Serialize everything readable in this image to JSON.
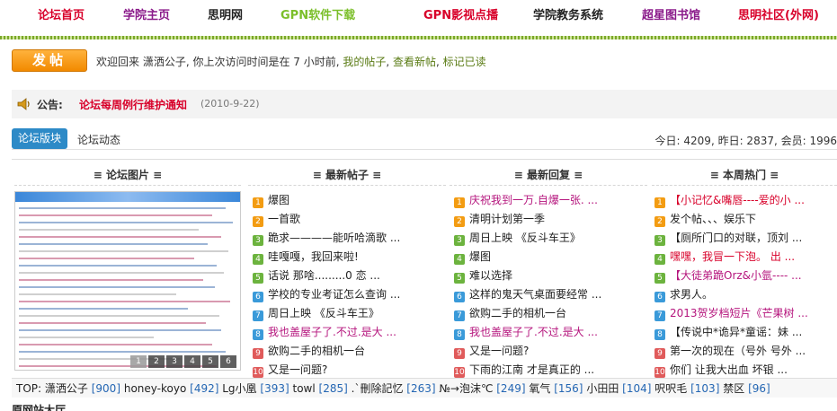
{
  "nav": [
    {
      "label": "论坛首页",
      "color": "#d8002a"
    },
    {
      "label": "学院主页",
      "color": "#8a1a8a"
    },
    {
      "label": "思明网",
      "color": "#222222"
    },
    {
      "label": "GPN软件下载",
      "color": "#7bbf2a"
    },
    {
      "label": "GPN影视点播",
      "color": "#d8002a"
    },
    {
      "label": "学院教务系统",
      "color": "#222222"
    },
    {
      "label": "超星图书馆",
      "color": "#8a1a8a"
    },
    {
      "label": "思明社区(外网)",
      "color": "#d8002a"
    }
  ],
  "userbar": {
    "post_button": "发帖",
    "welcome": "欢迎回来 潇洒公子, 你上次访问时间是在 7 小时前,",
    "my_posts": "我的帖子",
    "view_new": "查看新帖",
    "mark_read": "标记已读"
  },
  "announcement": {
    "label": "公告:",
    "title": "论坛每周例行维护通知",
    "date": "(2010-9-22)"
  },
  "tabs": {
    "active": "论坛版块",
    "other": "论坛动态"
  },
  "stats": "今日: 4209, 昨日: 2837, 会员: 1996",
  "columns": {
    "images": {
      "header": "≡ 论坛图片 ≡",
      "pages": [
        "1",
        "2",
        "3",
        "4",
        "5",
        "6"
      ]
    },
    "latest_posts": {
      "header": "≡ 最新帖子 ≡",
      "items": [
        {
          "text": "爆图",
          "color": "#222222"
        },
        {
          "text": "一首歌",
          "color": "#222222"
        },
        {
          "text": "跪求————能听哈滴歌 ...",
          "color": "#222222"
        },
        {
          "text": "哇嘎嘎，我回来啦!",
          "color": "#222222"
        },
        {
          "text": "话说 那啥.........0 恋 ...",
          "color": "#222222"
        },
        {
          "text": "学校的专业考证怎么查询 ...",
          "color": "#222222"
        },
        {
          "text": "周日上映 《反斗车王》",
          "color": "#222222"
        },
        {
          "text": "我也盖屋子了.不过.是大 ...",
          "color": "#b5157d"
        },
        {
          "text": "欲购二手的相机一台",
          "color": "#222222"
        },
        {
          "text": "又是一问题?",
          "color": "#222222"
        }
      ]
    },
    "latest_replies": {
      "header": "≡ 最新回复 ≡",
      "items": [
        {
          "text": "庆祝我到一万.自爆一张. ...",
          "color": "#b5157d"
        },
        {
          "text": "清明计划第一季",
          "color": "#222222"
        },
        {
          "text": "周日上映 《反斗车王》",
          "color": "#222222"
        },
        {
          "text": "爆图",
          "color": "#222222"
        },
        {
          "text": "难以选择",
          "color": "#222222"
        },
        {
          "text": "这样的鬼天气桌面要经常 ...",
          "color": "#222222"
        },
        {
          "text": "欲购二手的相机一台",
          "color": "#222222"
        },
        {
          "text": "我也盖屋子了.不过.是大 ...",
          "color": "#b5157d"
        },
        {
          "text": "又是一问题?",
          "color": "#222222"
        },
        {
          "text": "下雨的江南 才是真正的 ...",
          "color": "#222222"
        }
      ]
    },
    "weekly_hot": {
      "header": "≡ 本周热门 ≡",
      "items": [
        {
          "text": "【小记忆&嘴唇----爱的小 ...",
          "color": "#d8002a"
        },
        {
          "text": "发个帖、、、娱乐下",
          "color": "#222222"
        },
        {
          "text": "【厕所门口的对联，顶刘 ...",
          "color": "#222222"
        },
        {
          "text": "嘿嘿，我冒一下泡。 出 ...",
          "color": "#d8002a"
        },
        {
          "text": "【大徒弟跪Orz&小氩---- ...",
          "color": "#b5157d"
        },
        {
          "text": "求男人。",
          "color": "#222222"
        },
        {
          "text": "2013贺岁档短片《芒果树 ...",
          "color": "#b5157d"
        },
        {
          "text": "【传说中*诡异*童谣：妹 ...",
          "color": "#222222"
        },
        {
          "text": "第一次的现在（号外 号外 ...",
          "color": "#222222"
        },
        {
          "text": "你们 让我大出血 坏银 ...",
          "color": "#222222"
        }
      ]
    }
  },
  "num_colors": [
    "#f39c12",
    "#f39c12",
    "#6cb33e",
    "#6cb33e",
    "#6cb33e",
    "#3a9ad9",
    "#3a9ad9",
    "#3a9ad9",
    "#e05b5b",
    "#e05b5b"
  ],
  "top_posters": {
    "label": "TOP:",
    "users": [
      {
        "name": "潇洒公子",
        "count": "[900]"
      },
      {
        "name": "honey-koyo",
        "count": "[492]"
      },
      {
        "name": "Lg小凰",
        "count": "[393]"
      },
      {
        "name": "towl",
        "count": "[285]"
      },
      {
        "name": ".`刪除記忆",
        "count": "[263]"
      },
      {
        "name": "№→泡沫℃",
        "count": "[249]"
      },
      {
        "name": "氧气",
        "count": "[156]"
      },
      {
        "name": "小田田",
        "count": "[104]"
      },
      {
        "name": "呎呎毛",
        "count": "[103]"
      },
      {
        "name": "禁区",
        "count": "[96]"
      }
    ]
  },
  "bottom_text": "原网站大厅"
}
